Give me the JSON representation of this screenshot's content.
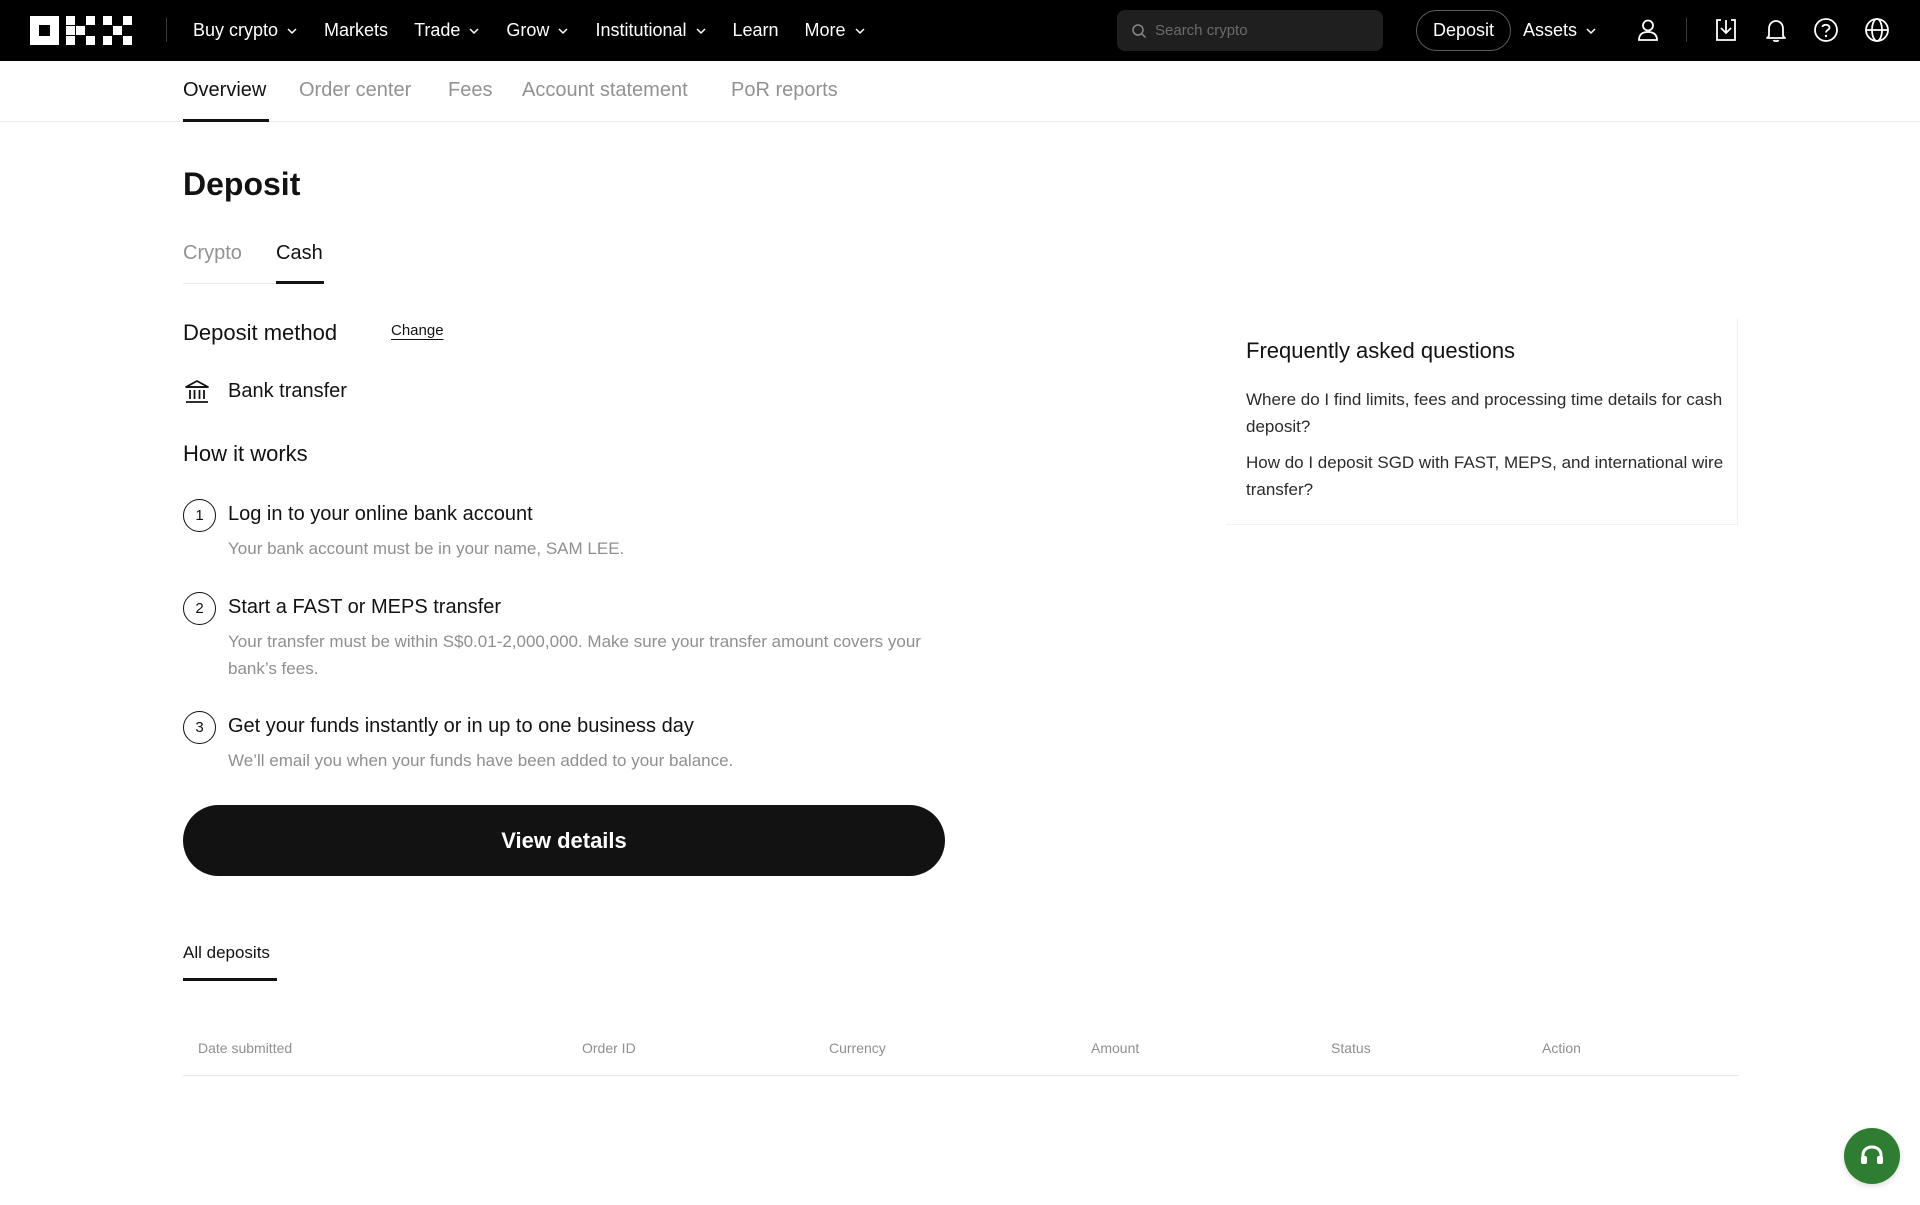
{
  "brand": {
    "name": "OKX"
  },
  "nav": {
    "items": [
      {
        "label": "Buy crypto",
        "has_dropdown": true
      },
      {
        "label": "Markets",
        "has_dropdown": false
      },
      {
        "label": "Trade",
        "has_dropdown": true
      },
      {
        "label": "Grow",
        "has_dropdown": true
      },
      {
        "label": "Institutional",
        "has_dropdown": true
      },
      {
        "label": "Learn",
        "has_dropdown": false
      },
      {
        "label": "More",
        "has_dropdown": true
      }
    ],
    "search_placeholder": "Search crypto",
    "deposit_label": "Deposit",
    "assets_label": "Assets",
    "icons": [
      "user-icon",
      "download-icon",
      "bell-icon",
      "help-icon",
      "globe-icon"
    ]
  },
  "subnav": {
    "tabs": [
      {
        "label": "Overview",
        "active": true
      },
      {
        "label": "Order center",
        "active": false
      },
      {
        "label": "Fees",
        "active": false
      },
      {
        "label": "Account statement",
        "active": false
      },
      {
        "label": "PoR reports",
        "active": false
      }
    ]
  },
  "page": {
    "title": "Deposit",
    "tabs": [
      {
        "label": "Crypto",
        "active": false
      },
      {
        "label": "Cash",
        "active": true
      }
    ],
    "deposit_method": {
      "heading": "Deposit method",
      "change_label": "Change",
      "method_label": "Bank transfer",
      "method_icon": "bank-icon"
    },
    "how_it_works": {
      "heading": "How it works",
      "steps": [
        {
          "num": "1",
          "title": "Log in to your online bank account",
          "desc": "Your bank account must be in your name, SAM LEE."
        },
        {
          "num": "2",
          "title": "Start a FAST or MEPS transfer",
          "desc": "Your transfer must be within S$0.01-2,000,000. Make sure your transfer amount covers your bank’s fees."
        },
        {
          "num": "3",
          "title": "Get your funds instantly or in up to one business day",
          "desc": "We’ll email you when your funds have been added to your balance."
        }
      ]
    },
    "view_details_label": "View details",
    "history": {
      "tab_label": "All deposits",
      "columns": [
        "Date submitted",
        "Order ID",
        "Currency",
        "Amount",
        "Status",
        "Action"
      ],
      "rows": []
    }
  },
  "faq": {
    "title": "Frequently asked questions",
    "questions": [
      "Where do I find limits, fees and processing time details for cash deposit?",
      "How do I deposit SGD with FAST, MEPS, and international wire transfer?"
    ]
  },
  "colors": {
    "nav_bg": "#000000",
    "text_primary": "#121212",
    "text_muted": "#929292",
    "support_green": "#2f7d32"
  }
}
